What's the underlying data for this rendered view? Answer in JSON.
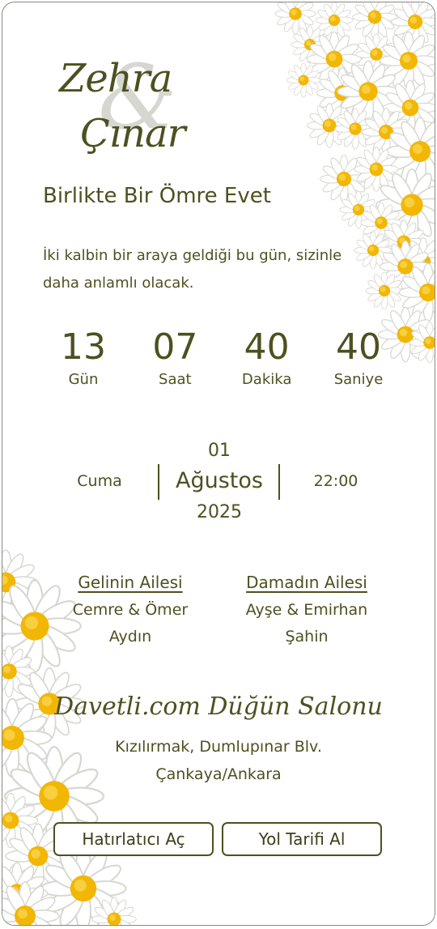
{
  "couple": {
    "name1": "Zehra",
    "ampersand": "&",
    "name2": "Çınar"
  },
  "tagline": "Birlikte Bir Ömre Evet",
  "intro": "İki kalbin bir araya geldiği bu gün, sizinle daha anlamlı olacak.",
  "countdown": [
    {
      "value": "13",
      "label": "Gün"
    },
    {
      "value": "07",
      "label": "Saat"
    },
    {
      "value": "40",
      "label": "Dakika"
    },
    {
      "value": "40",
      "label": "Saniye"
    }
  ],
  "date": {
    "weekday": "Cuma",
    "day": "01",
    "month": "Ağustos",
    "year": "2025",
    "time": "22:00"
  },
  "families": {
    "bride": {
      "title": "Gelinin Ailesi",
      "line1": "Cemre & Ömer",
      "line2": "Aydın"
    },
    "groom": {
      "title": "Damadın Ailesi",
      "line1": "Ayşe & Emirhan",
      "line2": "Şahin"
    }
  },
  "venue": {
    "name": "Davetli.com Düğün Salonu",
    "address_line1": "Kızılırmak, Dumlupınar Blv.",
    "address_line2": "Çankaya/Ankara"
  },
  "buttons": {
    "reminder": "Hatırlatıcı Aç",
    "directions": "Yol Tarifi Al"
  },
  "colors": {
    "accent": "#4d5120",
    "petal": "#ffffff",
    "flower_center": "#f2b705"
  }
}
